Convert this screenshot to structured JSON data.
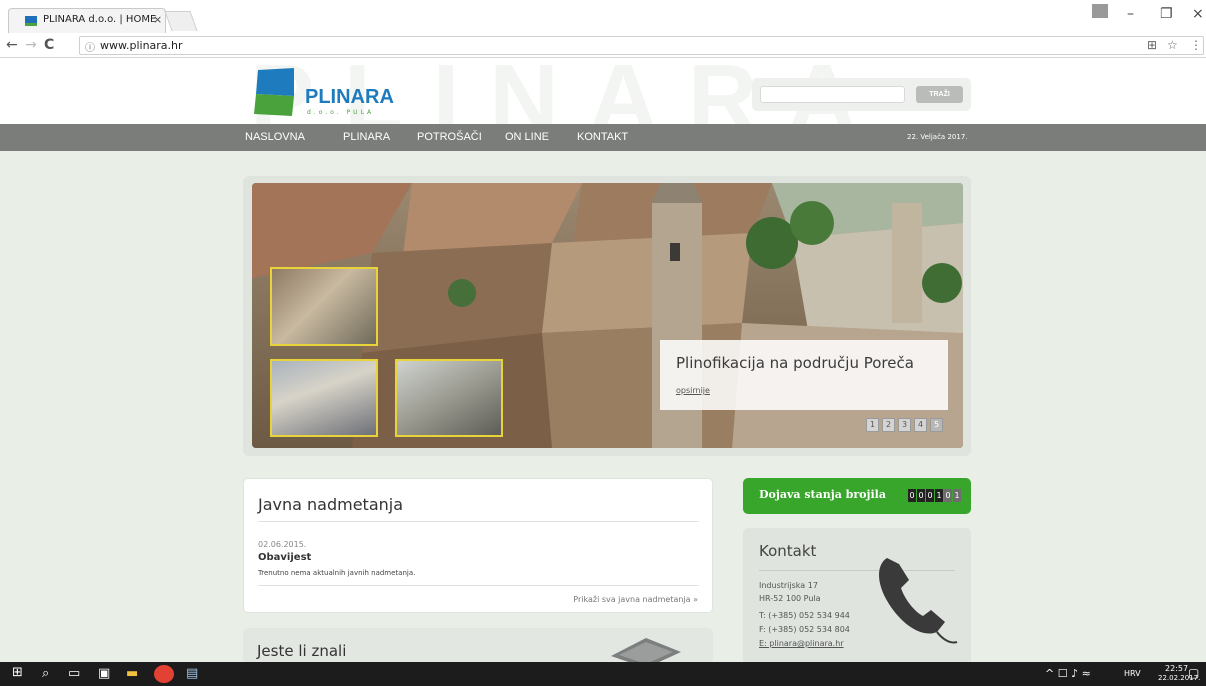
{
  "browser": {
    "tab_title": "PLINARA d.o.o. | HOME",
    "tab_close": "×",
    "url": "www.plinara.hr",
    "back": "←",
    "forward": "→",
    "reload": "C",
    "info_icon": "ⓘ",
    "translate_icon": "⊞",
    "star_icon": "☆",
    "menu_icon": "⋮",
    "minimize": "–",
    "restore": "❐",
    "close": "×"
  },
  "site": {
    "logo_name": "PLINARA",
    "logo_sub": "d.o.o. PULA",
    "search_placeholder": "",
    "search_button": "TRAŽI",
    "colors": {
      "blue": "#1e7bbd",
      "green": "#4aa23c",
      "nav_gray": "#7b7d7b",
      "meter_green": "#38a52b"
    }
  },
  "nav": {
    "items": [
      "NASLOVNA",
      "PLINARA",
      "POTROŠAČI",
      "ON LINE",
      "KONTAKT"
    ],
    "date": "22. Veljača 2017."
  },
  "slider": {
    "caption_title": "Plinofikacija na području Poreča",
    "caption_more": "opsirnije",
    "pages": [
      "1",
      "2",
      "3",
      "4",
      "5"
    ],
    "active_page": "5"
  },
  "tenders": {
    "title": "Javna nadmetanja",
    "date": "02.06.2015.",
    "headline": "Obavijest",
    "text": "Trenutno nema aktualnih javnih nadmetanja.",
    "show_all": "Prikaži sva javna nadmetanja »"
  },
  "did_you_know": {
    "title": "Jeste li znali"
  },
  "meter": {
    "title": "Dojava stanja brojila",
    "digits": [
      "0",
      "0",
      "0",
      "1",
      "0",
      "1"
    ]
  },
  "contact": {
    "title": "Kontakt",
    "address1": "Industrijska 17",
    "address2": "HR-52 100 Pula",
    "phone": "T: (+385) 052 534 944",
    "fax": "F: (+385) 052 534 804",
    "email": "E: plinara@plinara.hr"
  },
  "taskbar": {
    "lang": "HRV",
    "time": "22:57",
    "date": "22.02.2017."
  }
}
